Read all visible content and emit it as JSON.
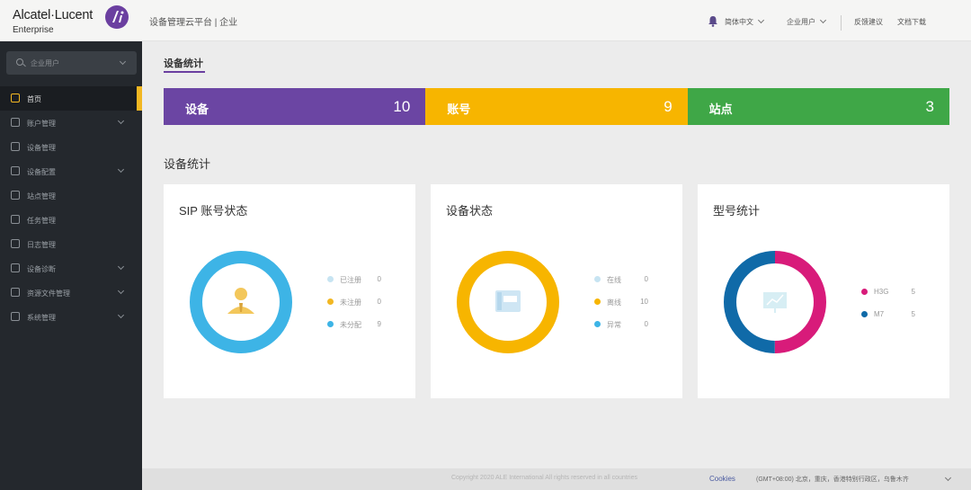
{
  "brand": {
    "name": "Alcatel·Lucent",
    "sub": "Enterprise"
  },
  "app_title": "设备管理云平台 | 企业",
  "header": {
    "language": "简体中文",
    "user": "企业用户",
    "feedback": "反馈建议",
    "docs": "文档下载"
  },
  "sidebar": {
    "search_text": "企业用户",
    "items": [
      {
        "label": "首页",
        "icon": "home-icon",
        "active": true,
        "expand": false
      },
      {
        "label": "账户管理",
        "icon": "account-icon",
        "expand": true
      },
      {
        "label": "设备管理",
        "icon": "device-icon",
        "expand": false
      },
      {
        "label": "设备配置",
        "icon": "config-icon",
        "expand": true
      },
      {
        "label": "站点管理",
        "icon": "site-icon",
        "expand": false
      },
      {
        "label": "任务管理",
        "icon": "task-icon",
        "expand": false
      },
      {
        "label": "日志管理",
        "icon": "log-icon",
        "expand": false
      },
      {
        "label": "设备诊断",
        "icon": "diagnose-icon",
        "expand": true
      },
      {
        "label": "资源文件管理",
        "icon": "files-icon",
        "expand": true
      },
      {
        "label": "系统管理",
        "icon": "system-icon",
        "expand": true
      }
    ]
  },
  "main": {
    "tab": "设备统计",
    "stats": [
      {
        "label": "设备",
        "value": "10",
        "color": "#6b45a3"
      },
      {
        "label": "账号",
        "value": "9",
        "color": "#f7b500"
      },
      {
        "label": "站点",
        "value": "3",
        "color": "#3fa747"
      }
    ],
    "section_title": "设备统计",
    "cards": [
      {
        "title": "SIP 账号状态",
        "center_icon": "user-icon",
        "legend": [
          {
            "label": "已注册",
            "value": 0,
            "color": "#c7e4f2"
          },
          {
            "label": "未注册",
            "value": 0,
            "color": "#f2b722"
          },
          {
            "label": "未分配",
            "value": 9,
            "color": "#3db4e6"
          }
        ]
      },
      {
        "title": "设备状态",
        "center_icon": "phone-icon",
        "legend": [
          {
            "label": "在线",
            "value": 0,
            "color": "#c7e4f2"
          },
          {
            "label": "离线",
            "value": 10,
            "color": "#f7b500"
          },
          {
            "label": "异常",
            "value": 0,
            "color": "#3db4e6"
          }
        ]
      },
      {
        "title": "型号统计",
        "center_icon": "chart-icon",
        "legend": [
          {
            "label": "H3G",
            "value": 5,
            "color": "#d81b7a"
          },
          {
            "label": "M7",
            "value": 5,
            "color": "#106aa8"
          }
        ]
      }
    ]
  },
  "footer": {
    "copyright": "Copyright 2020 ALE International All rights reserved in all countries",
    "cookies": "Cookies",
    "timezone": "(GMT+08:00) 北京，重庆，香港特别行政区，乌鲁木齐"
  }
}
